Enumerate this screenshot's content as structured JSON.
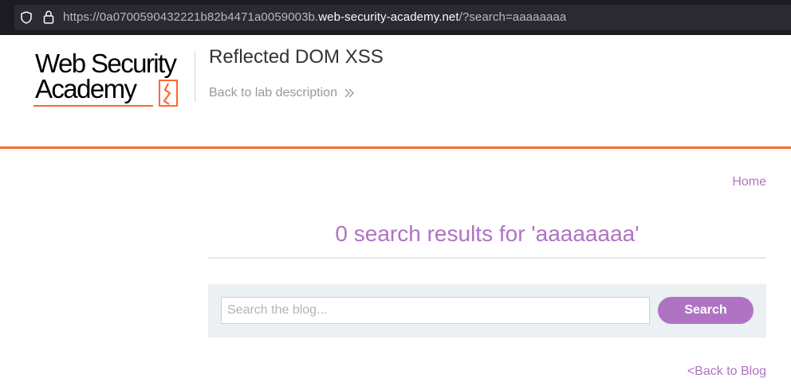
{
  "browser": {
    "url_prefix": "https://0a0700590432221b82b4471a0059003b.",
    "url_host": "web-security-academy.net",
    "url_suffix": "/?search=aaaaaaaa"
  },
  "header": {
    "logo_line1": "Web Security",
    "logo_line2": "Academy",
    "lab_title": "Reflected DOM XSS",
    "back_to_lab": "Back to lab description"
  },
  "nav": {
    "home": "Home"
  },
  "results": {
    "heading": "0 search results for 'aaaaaaaa'"
  },
  "search": {
    "placeholder": "Search the blog...",
    "button_label": "Search"
  },
  "footer": {
    "back_to_blog": "<Back to Blog"
  },
  "colors": {
    "accent": "#b073c4",
    "rule": "#ff6633",
    "logo_mark": "#ff6633"
  },
  "icons": [
    "shield-icon",
    "lock-icon",
    "chevron-right-double-icon",
    "academy-logo-mark"
  ]
}
